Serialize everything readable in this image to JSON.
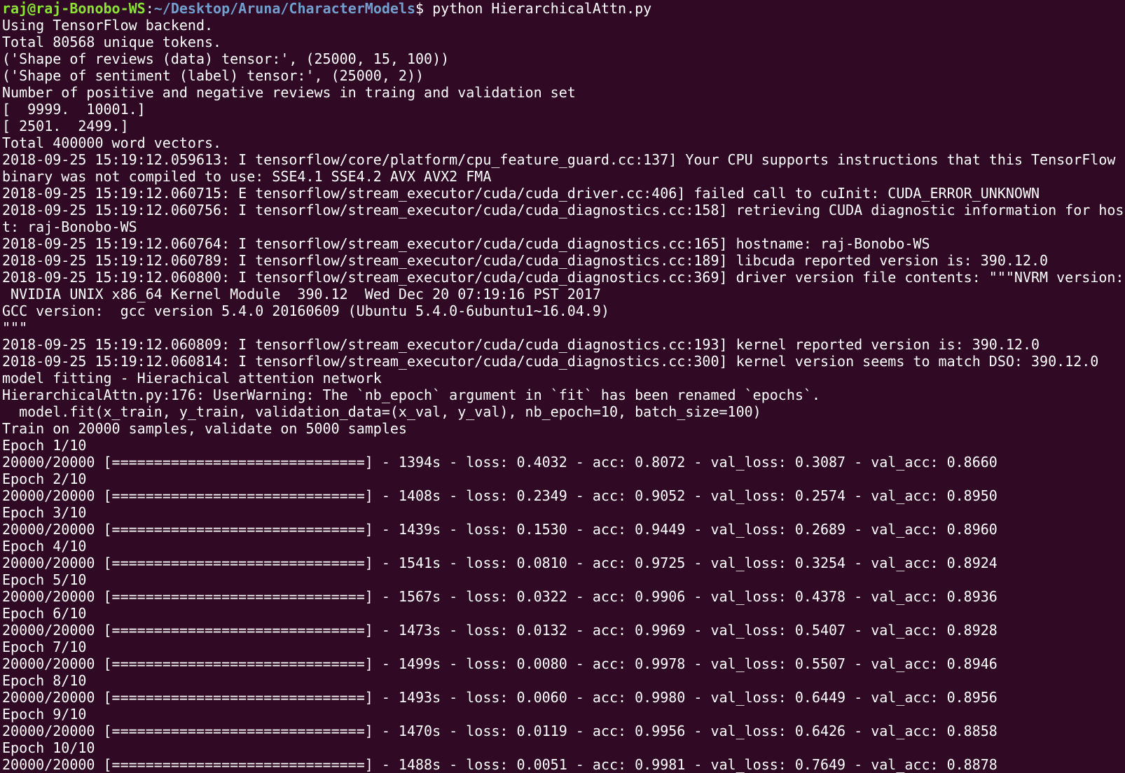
{
  "colors": {
    "background": "#300a24",
    "foreground": "#ffffff",
    "prompt_user": "#8ae234",
    "prompt_path": "#729fcf"
  },
  "prompt": {
    "user_host": "raj@raj-Bonobo-WS",
    "separator": ":",
    "path": "~/Desktop/Aruna/CharacterModels",
    "dollar": "$ ",
    "command": "python HierarchicalAttn.py"
  },
  "output": [
    "Using TensorFlow backend.",
    "Total 80568 unique tokens.",
    "('Shape of reviews (data) tensor:', (25000, 15, 100))",
    "('Shape of sentiment (label) tensor:', (25000, 2))",
    "Number of positive and negative reviews in traing and validation set",
    "[  9999.  10001.]",
    "[ 2501.  2499.]",
    "Total 400000 word vectors.",
    "2018-09-25 15:19:12.059613: I tensorflow/core/platform/cpu_feature_guard.cc:137] Your CPU supports instructions that this TensorFlow",
    "binary was not compiled to use: SSE4.1 SSE4.2 AVX AVX2 FMA",
    "2018-09-25 15:19:12.060715: E tensorflow/stream_executor/cuda/cuda_driver.cc:406] failed call to cuInit: CUDA_ERROR_UNKNOWN",
    "2018-09-25 15:19:12.060756: I tensorflow/stream_executor/cuda/cuda_diagnostics.cc:158] retrieving CUDA diagnostic information for hos",
    "t: raj-Bonobo-WS",
    "2018-09-25 15:19:12.060764: I tensorflow/stream_executor/cuda/cuda_diagnostics.cc:165] hostname: raj-Bonobo-WS",
    "2018-09-25 15:19:12.060789: I tensorflow/stream_executor/cuda/cuda_diagnostics.cc:189] libcuda reported version is: 390.12.0",
    "2018-09-25 15:19:12.060800: I tensorflow/stream_executor/cuda/cuda_diagnostics.cc:369] driver version file contents: \"\"\"NVRM version:",
    " NVIDIA UNIX x86_64 Kernel Module  390.12  Wed Dec 20 07:19:16 PST 2017",
    "GCC version:  gcc version 5.4.0 20160609 (Ubuntu 5.4.0-6ubuntu1~16.04.9)",
    "\"\"\"",
    "2018-09-25 15:19:12.060809: I tensorflow/stream_executor/cuda/cuda_diagnostics.cc:193] kernel reported version is: 390.12.0",
    "2018-09-25 15:19:12.060814: I tensorflow/stream_executor/cuda/cuda_diagnostics.cc:300] kernel version seems to match DSO: 390.12.0",
    "model fitting - Hierachical attention network",
    "HierarchicalAttn.py:176: UserWarning: The `nb_epoch` argument in `fit` has been renamed `epochs`.",
    "  model.fit(x_train, y_train, validation_data=(x_val, y_val), nb_epoch=10, batch_size=100)",
    "Train on 20000 samples, validate on 5000 samples",
    "Epoch 1/10",
    "20000/20000 [==============================] - 1394s - loss: 0.4032 - acc: 0.8072 - val_loss: 0.3087 - val_acc: 0.8660",
    "Epoch 2/10",
    "20000/20000 [==============================] - 1408s - loss: 0.2349 - acc: 0.9052 - val_loss: 0.2574 - val_acc: 0.8950",
    "Epoch 3/10",
    "20000/20000 [==============================] - 1439s - loss: 0.1530 - acc: 0.9449 - val_loss: 0.2689 - val_acc: 0.8960",
    "Epoch 4/10",
    "20000/20000 [==============================] - 1541s - loss: 0.0810 - acc: 0.9725 - val_loss: 0.3254 - val_acc: 0.8924",
    "Epoch 5/10",
    "20000/20000 [==============================] - 1567s - loss: 0.0322 - acc: 0.9906 - val_loss: 0.4378 - val_acc: 0.8936",
    "Epoch 6/10",
    "20000/20000 [==============================] - 1473s - loss: 0.0132 - acc: 0.9969 - val_loss: 0.5407 - val_acc: 0.8928",
    "Epoch 7/10",
    "20000/20000 [==============================] - 1499s - loss: 0.0080 - acc: 0.9978 - val_loss: 0.5507 - val_acc: 0.8946",
    "Epoch 8/10",
    "20000/20000 [==============================] - 1493s - loss: 0.0060 - acc: 0.9980 - val_loss: 0.6449 - val_acc: 0.8956",
    "Epoch 9/10",
    "20000/20000 [==============================] - 1470s - loss: 0.0119 - acc: 0.9956 - val_loss: 0.6426 - val_acc: 0.8858",
    "Epoch 10/10",
    "20000/20000 [==============================] - 1488s - loss: 0.0051 - acc: 0.9981 - val_loss: 0.7649 - val_acc: 0.8878"
  ]
}
